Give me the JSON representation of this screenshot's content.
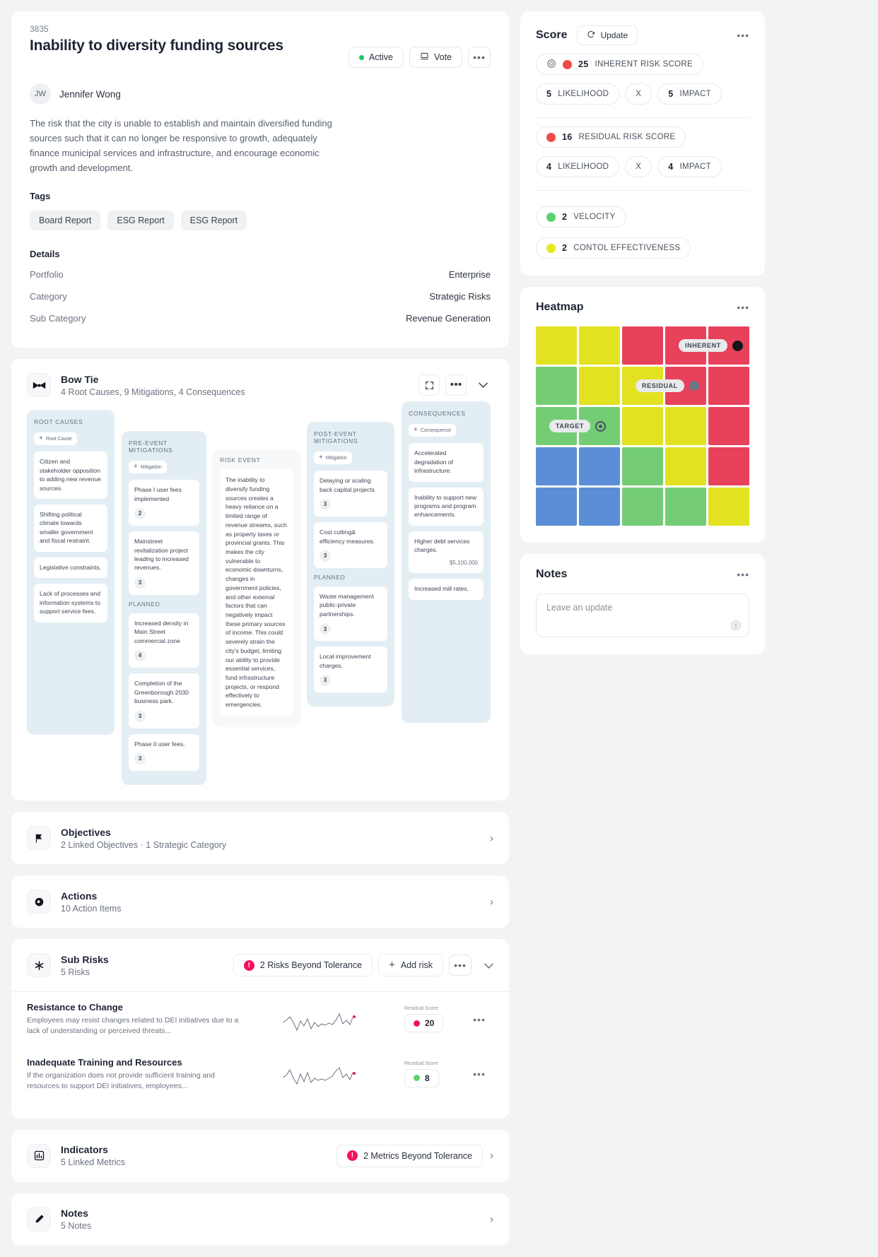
{
  "header": {
    "id": "3835",
    "title": "Inability to diversity funding sources",
    "status_label": "Active",
    "vote_label": "Vote",
    "more_label": "•••",
    "owner_initials": "JW",
    "owner_name": "Jennifer Wong",
    "description": "The risk that the city is unable to establish and maintain diversified funding sources such that it can no longer be responsive to growth, adequately finance municipal services and infrastructure, and encourage economic growth and development.",
    "tags_label": "Tags",
    "tags": [
      "Board Report",
      "ESG Report",
      "ESG Report"
    ],
    "details_label": "Details",
    "details": [
      {
        "key": "Portfolio",
        "value": "Enterprise"
      },
      {
        "key": "Category",
        "value": "Strategic Risks"
      },
      {
        "key": "Sub Category",
        "value": "Revenue Generation"
      }
    ]
  },
  "bowtie": {
    "title": "Bow Tie",
    "subtitle": "4 Root Causes, 9 Mitigations, 4 Consequences",
    "icon": "bowtie-icon",
    "expand_label": "⤡",
    "more_label": "•••",
    "collapse_label": "⌄",
    "root_causes": {
      "title": "ROOT CAUSES",
      "add_label": "Root Cause",
      "items": [
        {
          "text": "Citizen and stakeholder opposition to adding new revenue sources."
        },
        {
          "text": "Shifting political climate towards smaller government and fiscal restraint."
        },
        {
          "text": "Legislative constraints."
        },
        {
          "text": "Lack of processes and information systems to support service fees."
        }
      ]
    },
    "pre_event": {
      "title": "PRE-EVENT MITIGATIONS",
      "add_label": "Mitigation",
      "planned_label": "PLANNED",
      "items": [
        {
          "text": "Phase I user fees implemented",
          "score": "2"
        },
        {
          "text": "Mainstreet revitalization project leading to increased revenues.",
          "score": "3"
        }
      ],
      "planned_items": [
        {
          "text": "Increased density in Main Street commercial zone",
          "score": "4"
        },
        {
          "text": "Completion of the Greenborough 2030 business park.",
          "score": "3"
        },
        {
          "text": "Phase II user fees.",
          "score": "3"
        }
      ]
    },
    "risk_event": {
      "title": "RISK EVENT",
      "text": "The inability to diversify funding sources creates a heavy reliance on a limited range of revenue streams, such as property taxes or provincial grants. This makes the city vulnerable to economic downturns, changes in government policies, and other external factors that can negatively impact these primary sources of income. This could severely strain the city's budget, limiting our ability to provide essential services, fund infrastructure projects, or respond effectively to emergencies."
    },
    "post_event": {
      "title": "POST-EVENT MITIGATIONS",
      "add_label": "Mitigation",
      "planned_label": "PLANNED",
      "items": [
        {
          "text": "Delaying or scaling back capital projects",
          "score": "3"
        },
        {
          "text": "Cost cutting& efficiency measures.",
          "score": "3"
        }
      ],
      "planned_items": [
        {
          "text": "Waste management public-private partnerships.",
          "score": "3"
        },
        {
          "text": "Local improvement charges.",
          "score": "3"
        }
      ]
    },
    "consequences": {
      "title": "CONSEQUENCES",
      "add_label": "Consequence",
      "items": [
        {
          "text": "Accelerated degradation of infrastructure.",
          "money": ""
        },
        {
          "text": "Inability to support new programs and program enhancements.",
          "money": ""
        },
        {
          "text": "Higher debt services charges.",
          "money": "$5,100,000"
        },
        {
          "text": "Increased mill rates.",
          "money": ""
        }
      ]
    }
  },
  "sections": {
    "objectives": {
      "title": "Objectives",
      "subtitle": "2 Linked Objectives · 1 Strategic Category",
      "icon": "flag-icon",
      "chevron": "›"
    },
    "actions": {
      "title": "Actions",
      "subtitle": "10 Action Items",
      "icon": "target-icon",
      "chevron": "›"
    },
    "subrisks": {
      "title": "Sub Risks",
      "subtitle": "5 Risks",
      "icon": "asterisk-icon",
      "warning_label": "2 Risks Beyond Tolerance",
      "add_label": "Add risk",
      "more_label": "•••",
      "collapse_label": "⌄",
      "rows": [
        {
          "title": "Resistance to  Change",
          "desc": "Employees may resist changes related to DEI initiatives due to a lack of understanding or perceived threats...",
          "score_label": "Residual Score",
          "score": "20",
          "score_color": "#f31260",
          "more_label": "•••"
        },
        {
          "title": "Inadequate Training and Resources",
          "desc": " If the organization does not provide sufficient training and resources to support DEI initiatives, employees...",
          "score_label": "Residual Score",
          "score": "8",
          "score_color": "#5cd16f",
          "more_label": "•••"
        }
      ]
    },
    "indicators": {
      "title": "Indicators",
      "subtitle": "5 Linked Metrics",
      "icon": "bar-chart-icon",
      "warning_label": "2 Metrics Beyond Tolerance",
      "chevron": "›"
    },
    "notes": {
      "title": "Notes",
      "subtitle": "5 Notes",
      "icon": "pencil-icon",
      "chevron": "›"
    }
  },
  "score_panel": {
    "title": "Score",
    "update_label": "Update",
    "more_label": "•••",
    "inherent": {
      "value": "25",
      "label": "INHERENT RISK  SCORE",
      "color": "#ef4a4a"
    },
    "inherent_likelihood": {
      "value": "5",
      "label": "LIKELIHOOD"
    },
    "times_label": "X",
    "inherent_impact": {
      "value": "5",
      "label": "IMPACT"
    },
    "residual": {
      "value": "16",
      "label": "RESIDUAL RISK  SCORE",
      "color": "#ef4a4a"
    },
    "residual_likelihood": {
      "value": "4",
      "label": "LIKELIHOOD"
    },
    "residual_impact": {
      "value": "4",
      "label": "IMPACT"
    },
    "velocity": {
      "value": "2",
      "label": "VELOCITY",
      "color": "#5cd16f"
    },
    "control": {
      "value": "2",
      "label": "CONTOL EFFECTIVENESS",
      "color": "#e5e81f"
    }
  },
  "heatmap": {
    "title": "Heatmap",
    "more_label": "•••",
    "colors": {
      "green": "#74cd75",
      "yellow": "#e3e222",
      "red": "#e8415c",
      "blue": "#5b8ed6"
    },
    "grid": [
      [
        "yellow",
        "yellow",
        "red",
        "red",
        "red"
      ],
      [
        "green",
        "yellow",
        "yellow",
        "red",
        "red"
      ],
      [
        "green",
        "green",
        "yellow",
        "yellow",
        "red"
      ],
      [
        "blue",
        "blue",
        "green",
        "yellow",
        "red"
      ],
      [
        "blue",
        "blue",
        "green",
        "green",
        "yellow"
      ]
    ],
    "markers": [
      {
        "label": "INHERENT",
        "row": 0,
        "col": 4,
        "marker": "black"
      },
      {
        "label": "RESIDUAL",
        "row": 1,
        "col": 3,
        "marker": "grey"
      },
      {
        "label": "TARGET",
        "row": 2,
        "col": 1,
        "marker": "ring"
      }
    ]
  },
  "notes_panel": {
    "title": "Notes",
    "more_label": "•••",
    "placeholder": "Leave an update",
    "send_label": "↑"
  }
}
